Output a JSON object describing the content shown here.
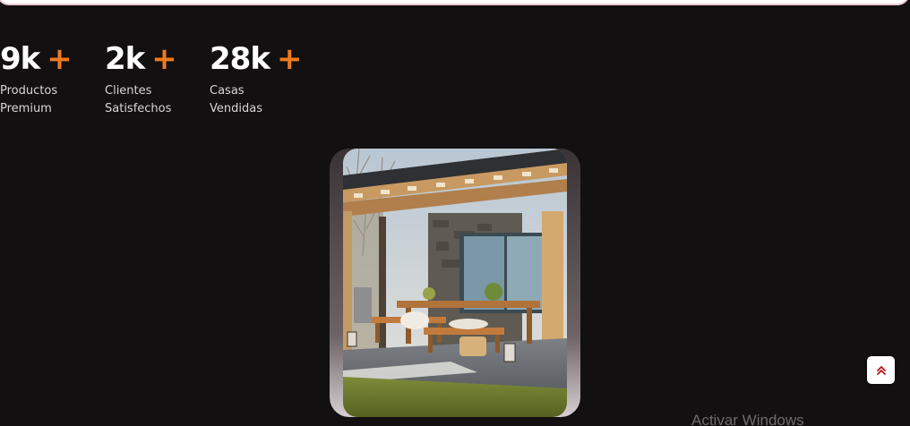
{
  "stats": [
    {
      "value": "9k",
      "plus": "+",
      "label": "Productos Premium"
    },
    {
      "value": "2k",
      "plus": "+",
      "label": "Clientes Satisfechos"
    },
    {
      "value": "28k",
      "plus": "+",
      "label": "Casas Vendidas"
    }
  ],
  "colors": {
    "accent": "#f07a1d",
    "background": "#121011"
  },
  "photo": {
    "icon": "outdoor-patio-photo"
  },
  "scroll_top": {
    "icon": "double-chevron-up-icon"
  },
  "watermark": {
    "text": "Activar Windows"
  }
}
